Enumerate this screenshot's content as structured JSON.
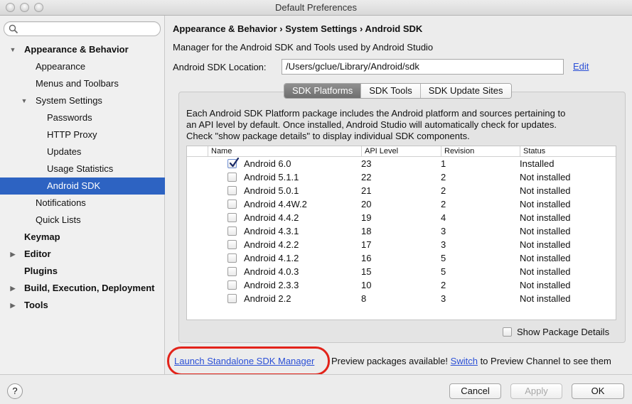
{
  "window": {
    "title": "Default Preferences"
  },
  "sidebar": {
    "search_placeholder": "",
    "items": [
      {
        "label": "Appearance & Behavior",
        "level": 0,
        "bold": true,
        "arrow": "down"
      },
      {
        "label": "Appearance",
        "level": 1
      },
      {
        "label": "Menus and Toolbars",
        "level": 1
      },
      {
        "label": "System Settings",
        "level": 1,
        "arrow": "down"
      },
      {
        "label": "Passwords",
        "level": 2
      },
      {
        "label": "HTTP Proxy",
        "level": 2
      },
      {
        "label": "Updates",
        "level": 2
      },
      {
        "label": "Usage Statistics",
        "level": 2
      },
      {
        "label": "Android SDK",
        "level": 2,
        "selected": true
      },
      {
        "label": "Notifications",
        "level": 1
      },
      {
        "label": "Quick Lists",
        "level": 1
      },
      {
        "label": "Keymap",
        "level": 0,
        "bold": true
      },
      {
        "label": "Editor",
        "level": 0,
        "bold": true,
        "arrow": "right"
      },
      {
        "label": "Plugins",
        "level": 0,
        "bold": true
      },
      {
        "label": "Build, Execution, Deployment",
        "level": 0,
        "bold": true,
        "arrow": "right"
      },
      {
        "label": "Tools",
        "level": 0,
        "bold": true,
        "arrow": "right"
      }
    ]
  },
  "main": {
    "breadcrumb": "Appearance & Behavior › System Settings › Android SDK",
    "description": "Manager for the Android SDK and Tools used by Android Studio",
    "sdk_location_label": "Android SDK Location:",
    "sdk_location_value": "/Users/gclue/Library/Android/sdk",
    "edit_label": "Edit",
    "tabs": [
      {
        "label": "SDK Platforms",
        "active": true
      },
      {
        "label": "SDK Tools"
      },
      {
        "label": "SDK Update Sites"
      }
    ],
    "info_lines": [
      "Each Android SDK Platform package includes the Android platform and sources pertaining to",
      "an API level by default. Once installed, Android Studio will automatically check for updates.",
      "Check \"show package details\" to display individual SDK components."
    ],
    "table": {
      "headers": [
        "Name",
        "API Level",
        "Revision",
        "Status"
      ],
      "rows": [
        {
          "name": "Android 6.0",
          "api": "23",
          "rev": "1",
          "status": "Installed",
          "checked": true
        },
        {
          "name": "Android 5.1.1",
          "api": "22",
          "rev": "2",
          "status": "Not installed",
          "checked": false
        },
        {
          "name": "Android 5.0.1",
          "api": "21",
          "rev": "2",
          "status": "Not installed",
          "checked": false
        },
        {
          "name": "Android 4.4W.2",
          "api": "20",
          "rev": "2",
          "status": "Not installed",
          "checked": false
        },
        {
          "name": "Android 4.4.2",
          "api": "19",
          "rev": "4",
          "status": "Not installed",
          "checked": false
        },
        {
          "name": "Android 4.3.1",
          "api": "18",
          "rev": "3",
          "status": "Not installed",
          "checked": false
        },
        {
          "name": "Android 4.2.2",
          "api": "17",
          "rev": "3",
          "status": "Not installed",
          "checked": false
        },
        {
          "name": "Android 4.1.2",
          "api": "16",
          "rev": "5",
          "status": "Not installed",
          "checked": false
        },
        {
          "name": "Android 4.0.3",
          "api": "15",
          "rev": "5",
          "status": "Not installed",
          "checked": false
        },
        {
          "name": "Android 2.3.3",
          "api": "10",
          "rev": "2",
          "status": "Not installed",
          "checked": false
        },
        {
          "name": "Android 2.2",
          "api": "8",
          "rev": "3",
          "status": "Not installed",
          "checked": false
        }
      ]
    },
    "show_package_details_label": "Show Package Details",
    "launch_label": "Launch Standalone SDK Manager",
    "preview_text_before": "Preview packages available! ",
    "switch_label": "Switch",
    "preview_text_after": " to Preview Channel to see them"
  },
  "footer": {
    "help_label": "?",
    "cancel_label": "Cancel",
    "apply_label": "Apply",
    "ok_label": "OK"
  },
  "colors": {
    "selection": "#2d63c2",
    "link": "#2a4fd6",
    "highlight_ring": "#e2231a"
  }
}
